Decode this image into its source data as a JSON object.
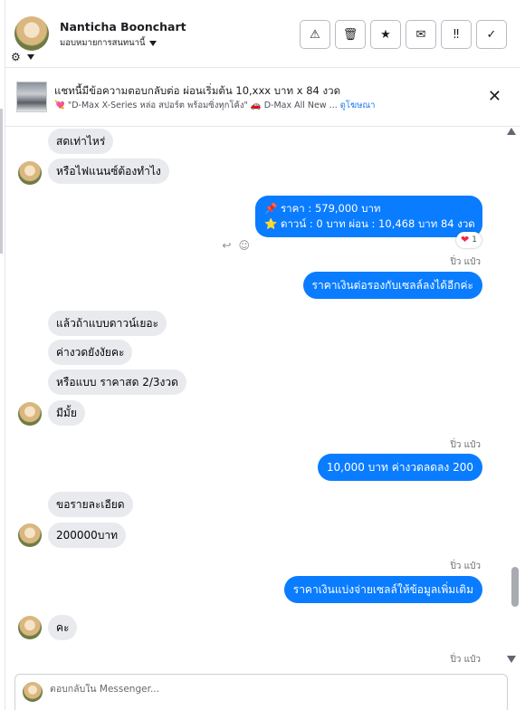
{
  "header": {
    "name": "Nanticha Boonchart",
    "assign_label": "มอบหมายการสนทนานี้",
    "toolbar": [
      {
        "name": "report-spam-button",
        "icon": "⚠",
        "icon_name": "warning-icon"
      },
      {
        "name": "delete-button",
        "icon": "🗑",
        "icon_name": "trash-icon"
      },
      {
        "name": "star-button",
        "icon": "★",
        "icon_name": "star-icon"
      },
      {
        "name": "mark-unread-button",
        "icon": "✉",
        "icon_name": "envelope-icon"
      },
      {
        "name": "follow-up-button",
        "icon": "‼",
        "icon_name": "double-exclamation-icon"
      },
      {
        "name": "mark-done-button",
        "icon": "✓",
        "icon_name": "check-icon"
      }
    ]
  },
  "ad": {
    "title": "แชทนี้มีข้อความตอบกลับต่อ ผ่อนเริ่มต้น 10,xxx บาท x 84 งวด",
    "sub_emoji": "💘",
    "sub_text": " \"D-Max X-Series หล่อ สปอร์ต พร้อมซิ่งทุกโค้ง\" 🚗 D-Max All New ... ",
    "sub_link": "ดูโฆษณา"
  },
  "messages": {
    "in1": "สดเท่าไหร่",
    "in2": "หรือไฟแนนซ์ต้องทำไง",
    "out1_line1": "📌 ราคา : 579,000 บาท",
    "out1_line2": "⭐ ดาวน์ : 0 บาท ผ่อน : 10,468 บาท 84 งวด",
    "reaction_count": "1",
    "seen1": "ปิ่ว แป๋ว",
    "out2": "ราคาเงินต่อรองกับเซลล์ลงได้อีกค่ะ",
    "in3": "แล้วถ้าแบบดาวน์เยอะ",
    "in4": "ค่างวดยังงัยคะ",
    "in5": "หรือแบบ ราคาสด 2/3งวด",
    "in6": "มีมั้ย",
    "seen2": "ปิ่ว แป๋ว",
    "out3": "10,000 บาท ค่างวดลดลง 200",
    "in7": "ขอรายละเอียด",
    "in8": "200000บาท",
    "seen3": "ปิ่ว แป๋ว",
    "out4": "ราคาเงินแบ่งจ่ายเซลล์ให้ข้อมูลเพิ่มเติม",
    "in9": "คะ",
    "seen4": "ปิ่ว แป๋ว"
  },
  "composer": {
    "placeholder": "ตอบกลับใน Messenger..."
  },
  "colors": {
    "outgoing": "#0a7cff",
    "incoming": "#e9eaed",
    "link": "#1877f2"
  }
}
